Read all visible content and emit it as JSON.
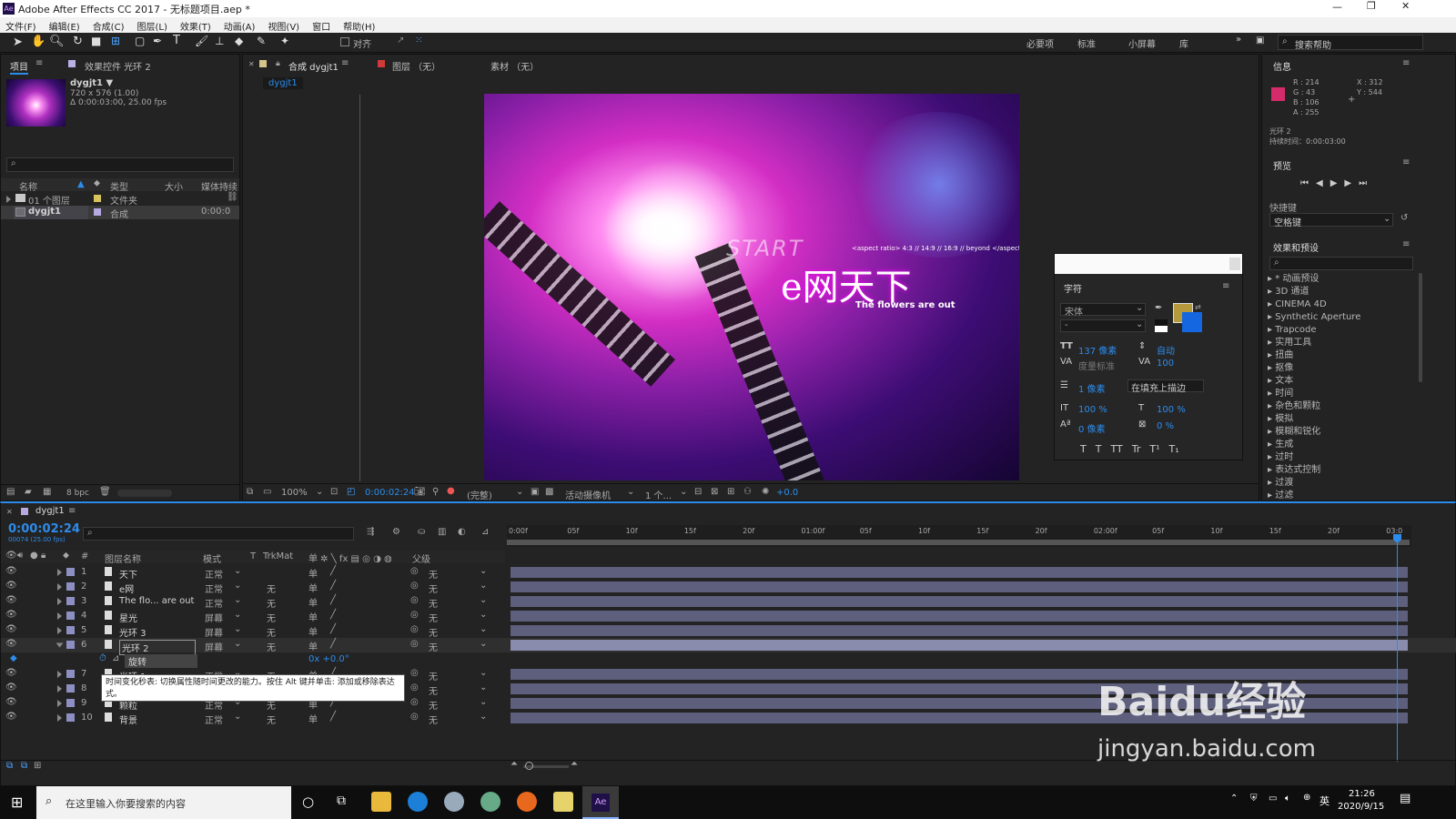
{
  "window": {
    "title": "Adobe After Effects CC 2017 - 无标题项目.aep *"
  },
  "menu": [
    "文件(F)",
    "编辑(E)",
    "合成(C)",
    "图层(L)",
    "效果(T)",
    "动画(A)",
    "视图(V)",
    "窗口",
    "帮助(H)"
  ],
  "toolbar": {
    "snap": "对齐",
    "workspaces": [
      "必要项",
      "标准",
      "小屏幕",
      "库"
    ],
    "search_placeholder": "搜索帮助"
  },
  "project": {
    "tab_project": "项目",
    "tab_effects": "效果控件 光环 2",
    "item_name": "dygjt1 ▼",
    "item_info1": "720 x 576 (1.00)",
    "item_info2": "Δ 0:00:03:00, 25.00 fps",
    "columns": [
      "名称",
      "类型",
      "大小",
      "媒体持续"
    ],
    "rows": [
      {
        "name": "01 个图层",
        "type": "文件夹",
        "dur": ""
      },
      {
        "name": "dygjt1",
        "type": "合成",
        "dur": "0:00:0"
      }
    ],
    "bpc": "8 bpc"
  },
  "comp": {
    "tab_comp": "合成 dygjt1",
    "tab_layer": "图层 （无）",
    "tab_footage": "素材 （无）",
    "sub_tab": "dygjt1",
    "zoom": "100%",
    "time": "0:00:02:24",
    "resolution": "(完整)",
    "camera": "活动摄像机",
    "views": "1 个...",
    "exposure": "+0.0"
  },
  "canvas": {
    "start": "START",
    "brand": "e网天下",
    "tagline": "The flowers are out",
    "aspect": "<aspect ratio> 4:3 // 14:9 // 16:9 // beyond </aspect"
  },
  "character": {
    "title": "字符",
    "font": "宋体",
    "style": "-",
    "size": "137 像素",
    "leading": "自动",
    "kerning": "度量标准",
    "tracking": "100",
    "stroke": "1 像素",
    "stroke_mode": "在填充上描边",
    "vscale": "100 %",
    "hscale": "100 %",
    "baseline": "0 像素",
    "tsume": "0 %",
    "styles": [
      "T",
      "T",
      "TT",
      "Tr",
      "T¹",
      "T₁"
    ]
  },
  "info": {
    "title": "信息",
    "r": "R : 214",
    "g": "G : 43",
    "b": "B : 106",
    "a": "A : 255",
    "x": "X : 312",
    "y": "Y : 544",
    "layer": "光环 2",
    "duration": "持续时间：0:00:03:00"
  },
  "preview": {
    "title": "预览"
  },
  "shortcut": {
    "label": "快捷键",
    "value": "空格键"
  },
  "effects": {
    "title": "效果和预设",
    "items": [
      "* 动画预设",
      "3D 通道",
      "CINEMA 4D",
      "Synthetic Aperture",
      "Trapcode",
      "实用工具",
      "扭曲",
      "抠像",
      "文本",
      "时间",
      "杂色和颗粒",
      "模拟",
      "模糊和锐化",
      "生成",
      "过时",
      "表达式控制",
      "过渡",
      "过滤"
    ]
  },
  "timeline": {
    "tab": "dygjt1",
    "time": "0:00:02:24",
    "fps": "00074 (25.00 fps)",
    "col_layer": "图层名称",
    "col_mode": "模式",
    "col_t": "T",
    "col_trk": "TrkMat",
    "col_parent": "父级",
    "ruler": [
      "0:00f",
      "05f",
      "10f",
      "15f",
      "20f",
      "01:00f",
      "05f",
      "10f",
      "15f",
      "20f",
      "02:00f",
      "05f",
      "10f",
      "15f",
      "20f",
      "03:0"
    ],
    "layers": [
      {
        "n": "1",
        "name": "天下",
        "mode": "正常",
        "trk": "",
        "parent": "无"
      },
      {
        "n": "2",
        "name": "e网",
        "mode": "正常",
        "trk": "无",
        "parent": "无"
      },
      {
        "n": "3",
        "name": "The flo... are out",
        "mode": "正常",
        "trk": "无",
        "parent": "无"
      },
      {
        "n": "4",
        "name": "星光",
        "mode": "屏幕",
        "trk": "无",
        "parent": "无"
      },
      {
        "n": "5",
        "name": "光环 3",
        "mode": "屏幕",
        "trk": "无",
        "parent": "无"
      },
      {
        "n": "6",
        "name": "光环 2",
        "mode": "屏幕",
        "trk": "无",
        "parent": "无"
      },
      {
        "n": "7",
        "name": "光环 1",
        "mode": "正常",
        "trk": "无",
        "parent": "无"
      },
      {
        "n": "8",
        "name": "",
        "mode": "",
        "trk": "无",
        "parent": "无"
      },
      {
        "n": "9",
        "name": "颗粒",
        "mode": "正常",
        "trk": "无",
        "parent": "无"
      },
      {
        "n": "10",
        "name": "背景",
        "mode": "正常",
        "trk": "无",
        "parent": "无"
      }
    ],
    "prop_name": "旋转",
    "prop_value": "0x +0.0°",
    "tooltip": "时间变化秒表: 切换属性随时间更改的能力。按住 Alt 键并单击: 添加或移除表达式。"
  },
  "taskbar": {
    "search": "在这里输入你要搜索的内容",
    "time": "21:26",
    "date": "2020/9/15",
    "ime": "英"
  },
  "watermark": {
    "brand": "Baidu经验",
    "url": "jingyan.baidu.com"
  }
}
